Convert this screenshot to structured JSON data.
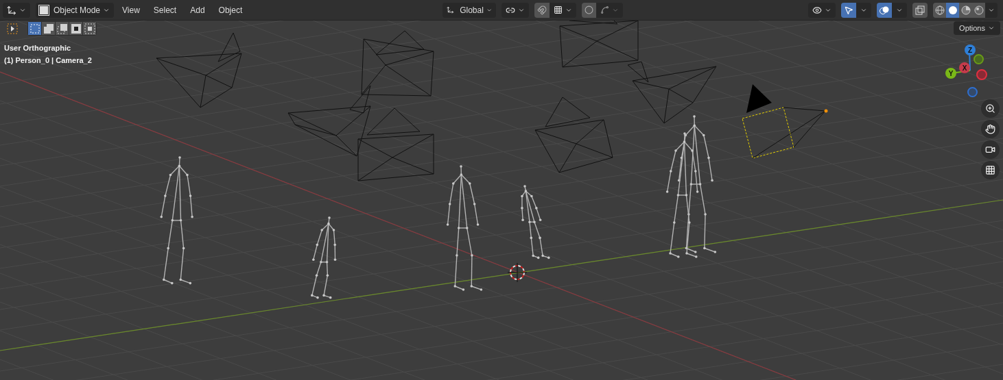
{
  "header": {
    "mode": "Object Mode",
    "menus": [
      "View",
      "Select",
      "Add",
      "Object"
    ],
    "transform_orientation": "Global",
    "snap": {
      "on": false
    },
    "proportional_editing": {
      "on": false
    },
    "gizmos": {
      "on": true
    },
    "overlays": {
      "on": true
    },
    "xray": {
      "on": false
    },
    "viewport_shading": [
      {
        "kind": "wireframe",
        "selected": false
      },
      {
        "kind": "solid",
        "selected": true
      },
      {
        "kind": "material",
        "selected": false
      },
      {
        "kind": "rendered",
        "selected": false
      }
    ]
  },
  "tool_settings": {
    "select_modes": [
      {
        "kind": "new",
        "selected": true
      },
      {
        "kind": "extend",
        "selected": false
      },
      {
        "kind": "subtract",
        "selected": false
      },
      {
        "kind": "invert",
        "selected": false
      },
      {
        "kind": "intersect",
        "selected": false
      }
    ]
  },
  "viewport": {
    "view_name": "User Orthographic",
    "active_object": "(1) Person_0 | Camera_2",
    "options_button": "Options",
    "navigation_gizmo": [
      {
        "kind": "z",
        "label": "Z"
      },
      {
        "kind": "x",
        "label": "X"
      },
      {
        "kind": "y",
        "label": "Y"
      }
    ]
  }
}
